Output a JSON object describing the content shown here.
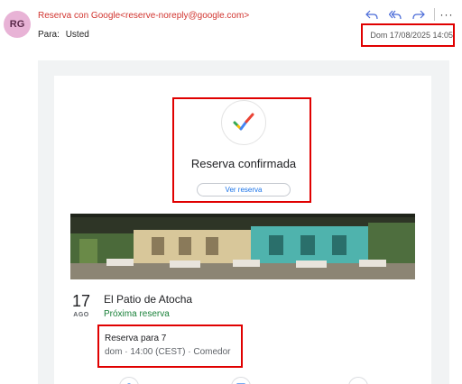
{
  "email": {
    "avatar_initials": "RG",
    "sender": "Reserva con Google<reserve-noreply@google.com>",
    "to_label": "Para:",
    "to_value": "Usted",
    "date": "Dom 17/08/2025 14:05",
    "actions": [
      "reply-icon",
      "reply-all-icon",
      "forward-icon",
      "more-options-icon"
    ],
    "more_label": "···"
  },
  "confirmation": {
    "title": "Reserva confirmada",
    "view_button": "Ver reserva"
  },
  "reservation": {
    "day": "17",
    "month": "AGO",
    "venue": "El Patio de Atocha",
    "status": "Próxima reserva",
    "party": "Reserva para 7",
    "details": "dom · 14:00 (CEST) · Comedor"
  },
  "colors": {
    "accent_blue": "#1a73e8",
    "sender_red": "#d1342f",
    "status_green": "#188038",
    "highlight_red": "#e00000"
  }
}
